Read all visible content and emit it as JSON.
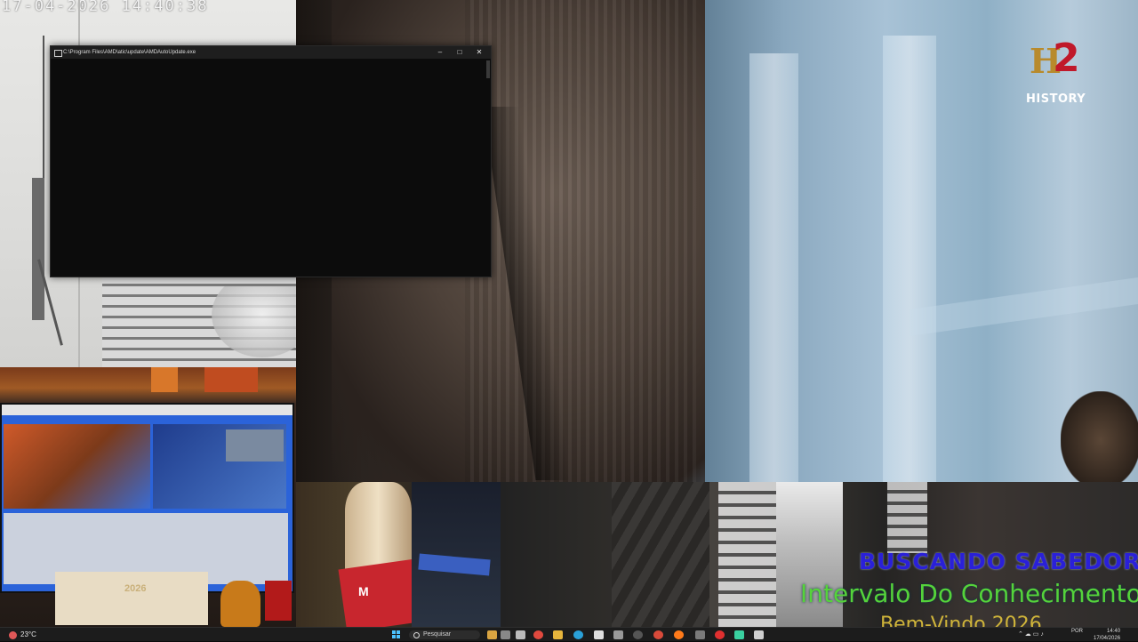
{
  "camera": {
    "timestamp": "17-04-2026 14:40:38"
  },
  "video": {
    "channel_logo_letters": "H",
    "channel_logo_number": "2",
    "channel_name": "HISTORY"
  },
  "console": {
    "title": "C:\\Program Files\\AMD\\atic\\update\\AMDAutoUpdate.exe",
    "minimize_glyph": "–",
    "maximize_glyph": "□",
    "close_glyph": "✕"
  },
  "desk": {
    "paper_text": "2026",
    "red_box_text": "M"
  },
  "overlay": {
    "line1": "BUSCANDO SABEDORIA",
    "line2": "Intervalo Do Conhecimento",
    "line3": "Bem-Vindo 2026"
  },
  "taskbar": {
    "weather": "23°C",
    "search_placeholder": "Pesquisar",
    "apps": [
      "explorer",
      "media-player",
      "task-view",
      "chrome",
      "folder",
      "edge",
      "store",
      "settings",
      "obs",
      "chrome-2",
      "firefox",
      "media",
      "rec",
      "terminal",
      "spotify",
      "other"
    ],
    "language": "POR",
    "clock_time": "14:40",
    "clock_date": "17/04/2026"
  },
  "colors": {
    "overlay_blue": "#2a20d8",
    "overlay_green": "#55d33a",
    "logo_red": "#c0182a",
    "logo_gold": "#b88a2c"
  }
}
